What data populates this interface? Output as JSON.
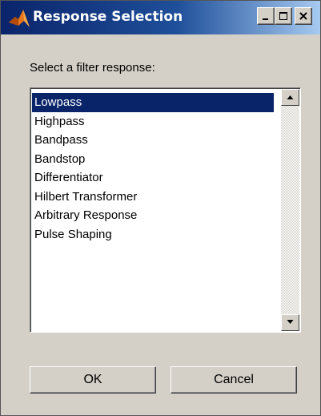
{
  "window": {
    "title": "Response Selection",
    "icon": "matlab-membrane-icon",
    "controls": [
      "minimize-icon",
      "maximize-icon",
      "close-icon"
    ]
  },
  "prompt": "Select a filter response:",
  "list": {
    "items": [
      "Lowpass",
      "Highpass",
      "Bandpass",
      "Bandstop",
      "Differentiator",
      "Hilbert Transformer",
      "Arbitrary Response",
      "Pulse Shaping"
    ],
    "selected": "Lowpass"
  },
  "buttons": {
    "ok": "OK",
    "cancel": "Cancel"
  },
  "colors": {
    "titlebar_start": "#0a246a",
    "titlebar_end": "#a6caf0",
    "selection": "#0a246a",
    "dialog_background": "#d4d0c8"
  }
}
